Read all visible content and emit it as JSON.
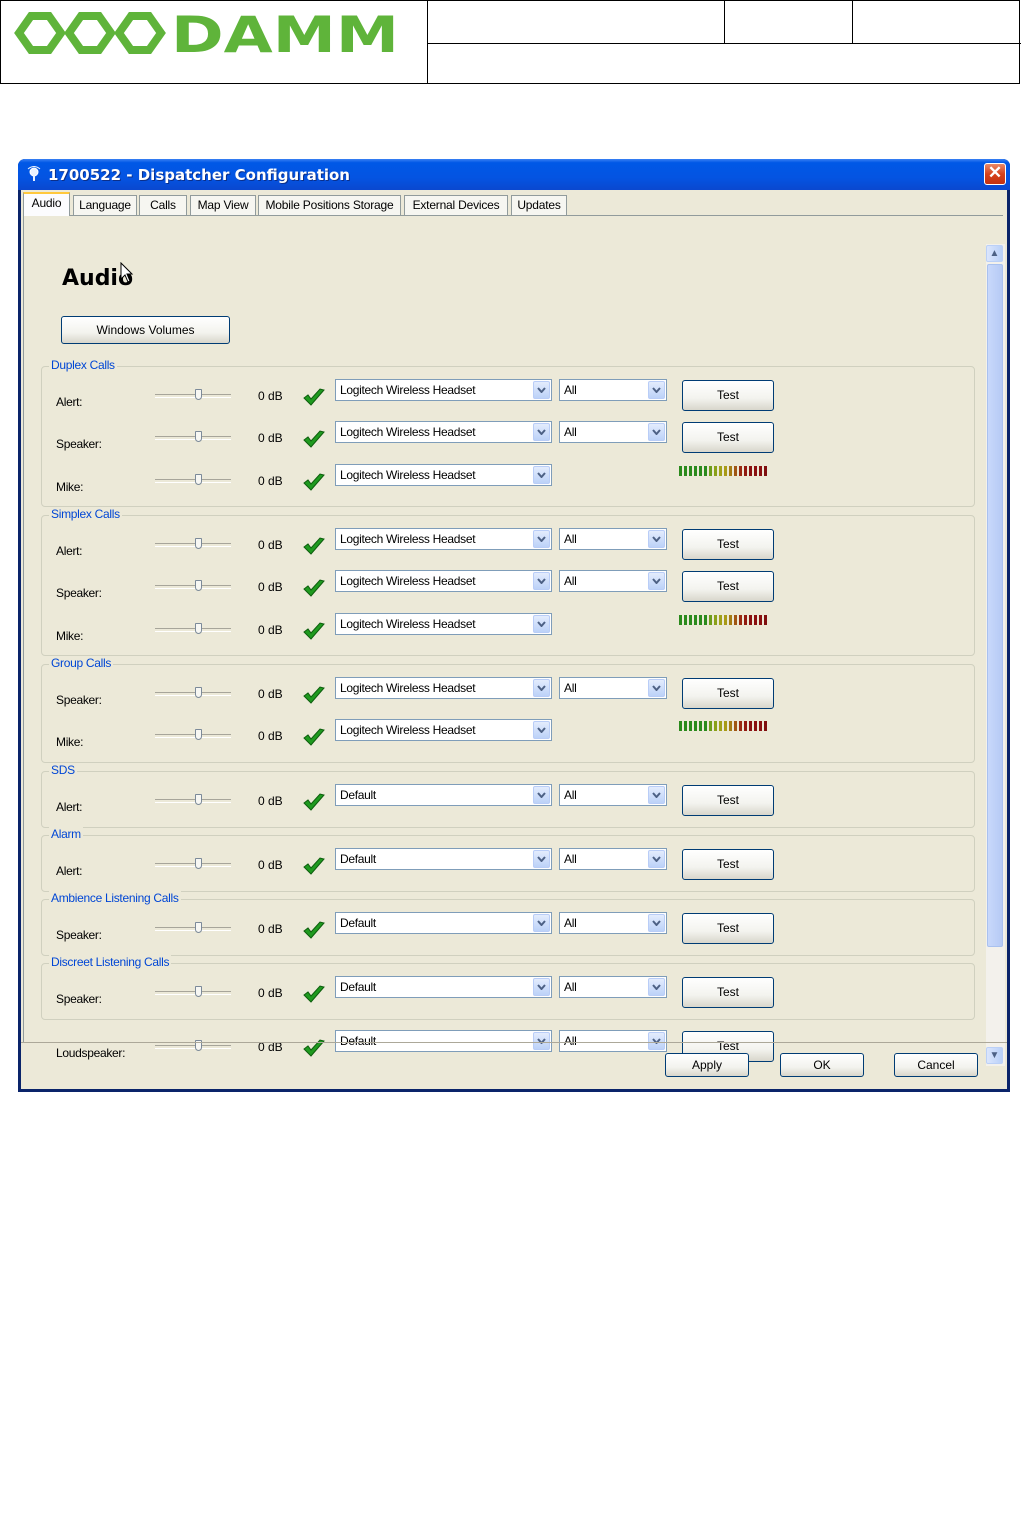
{
  "header": {
    "logo_text": "DAMM"
  },
  "window": {
    "title": "1700522 - Dispatcher Configuration",
    "close_icon": "close-icon",
    "tabs": [
      {
        "label": "Audio",
        "active": true
      },
      {
        "label": "Language"
      },
      {
        "label": "Calls"
      },
      {
        "label": "Map View"
      },
      {
        "label": "Mobile Positions Storage"
      },
      {
        "label": "External Devices"
      },
      {
        "label": "Updates"
      }
    ]
  },
  "audio": {
    "heading": "Audio",
    "windows_volumes": "Windows Volumes",
    "groups": [
      {
        "title": "Duplex Calls",
        "rows": [
          {
            "label": "Alert:",
            "db": "0 dB",
            "device": "Logitech Wireless Headset",
            "channel": "All",
            "action": "Test"
          },
          {
            "label": "Speaker:",
            "db": "0 dB",
            "device": "Logitech Wireless Headset",
            "channel": "All",
            "action": "Test"
          },
          {
            "label": "Mike:",
            "db": "0 dB",
            "device": "Logitech Wireless Headset"
          }
        ]
      },
      {
        "title": "Simplex Calls",
        "rows": [
          {
            "label": "Alert:",
            "db": "0 dB",
            "device": "Logitech Wireless Headset",
            "channel": "All",
            "action": "Test"
          },
          {
            "label": "Speaker:",
            "db": "0 dB",
            "device": "Logitech Wireless Headset",
            "channel": "All",
            "action": "Test"
          },
          {
            "label": "Mike:",
            "db": "0 dB",
            "device": "Logitech Wireless Headset"
          }
        ]
      },
      {
        "title": "Group Calls",
        "rows": [
          {
            "label": "Speaker:",
            "db": "0 dB",
            "device": "Logitech Wireless Headset",
            "channel": "All",
            "action": "Test"
          },
          {
            "label": "Mike:",
            "db": "0 dB",
            "device": "Logitech Wireless Headset"
          }
        ]
      },
      {
        "title": "SDS",
        "rows": [
          {
            "label": "Alert:",
            "db": "0 dB",
            "device": "Default",
            "channel": "All",
            "action": "Test"
          }
        ]
      },
      {
        "title": "Alarm",
        "rows": [
          {
            "label": "Alert:",
            "db": "0 dB",
            "device": "Default",
            "channel": "All",
            "action": "Test"
          }
        ]
      },
      {
        "title": "Ambience Listening Calls",
        "rows": [
          {
            "label": "Speaker:",
            "db": "0 dB",
            "device": "Default",
            "channel": "All",
            "action": "Test"
          }
        ]
      },
      {
        "title": "Discreet Listening Calls",
        "rows": [
          {
            "label": "Speaker:",
            "db": "0 dB",
            "device": "Default",
            "channel": "All",
            "action": "Test"
          }
        ]
      }
    ],
    "loudspeaker": {
      "label": "Loudspeaker:",
      "db": "0 dB",
      "device": "Default",
      "channel": "All",
      "action": "Test"
    }
  },
  "footer": {
    "apply": "Apply",
    "ok": "OK",
    "cancel": "Cancel"
  },
  "colors": {
    "titlebar": "#0454e2",
    "group_title": "#0046d5",
    "check": "#1f9a1f",
    "dialog_bg": "#ece9d8"
  }
}
